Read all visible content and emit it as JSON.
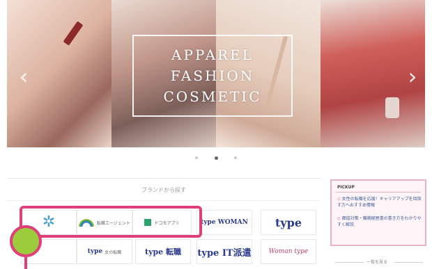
{
  "hero": {
    "title_lines": [
      "APPAREL",
      "FASHION",
      "COSMETIC"
    ],
    "arrow_left": "‹",
    "arrow_right": "›",
    "dots": 3,
    "active_dot": 2
  },
  "brands": {
    "heading": "ブランドから探す",
    "row1": [
      "",
      "",
      "",
      "type WOMAN",
      "type"
    ],
    "row2": [
      "",
      "type",
      "type 転職",
      "type IT派遣",
      "Woman type"
    ],
    "small_labels": {
      "l2": "転職エージェント",
      "l3": "ドコモアプリ",
      "l7": "女の転職"
    },
    "icons": {
      "l1": "star-logo-icon",
      "l2": "rainbow-logo-icon",
      "l3": "green-badge-icon"
    }
  },
  "sidebar": {
    "title": "PICKUP",
    "links": [
      "女性の転職を応援！キャリアアップを目指す方へおすすめ情報",
      "面接対策・職務経歴書の書き方をわかりやすく解説"
    ],
    "footer": "一覧を見る"
  },
  "colors": {
    "highlight": "#e0407a",
    "marker": "#9ccc3c",
    "brand_blue": "#2b3a8f"
  }
}
